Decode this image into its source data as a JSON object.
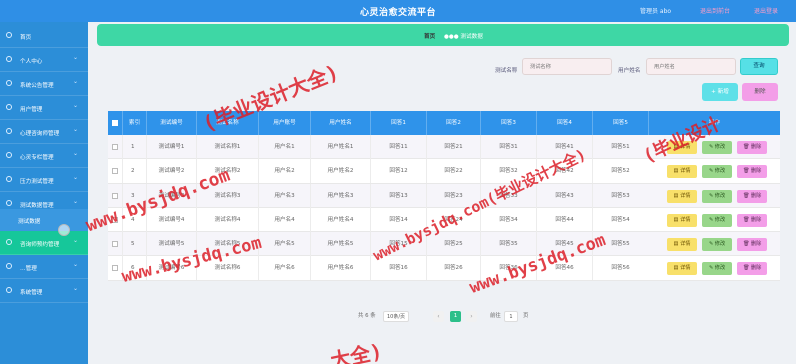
{
  "header": {
    "title": "心灵治愈交流平台",
    "user": "管理员 abo",
    "exit_label": "退出到前台",
    "logout_label": "退出登录"
  },
  "sidebar": {
    "items": [
      {
        "label": "首页",
        "chevron": false,
        "active": false
      },
      {
        "label": "个人中心",
        "chevron": true,
        "active": false
      },
      {
        "label": "系统公告管理",
        "chevron": true,
        "active": false
      },
      {
        "label": "用户管理",
        "chevron": true,
        "active": false
      },
      {
        "label": "心理咨询师管理",
        "chevron": true,
        "active": false
      },
      {
        "label": "心灵专栏管理",
        "chevron": true,
        "active": false
      },
      {
        "label": "压力测试管理",
        "chevron": true,
        "active": false
      },
      {
        "label": "测试数据管理",
        "chevron": true,
        "active": false
      },
      {
        "label": "咨询师预约管理",
        "chevron": true,
        "active": true
      },
      {
        "label": "…管理",
        "chevron": true,
        "active": false
      },
      {
        "label": "系统管理",
        "chevron": true,
        "active": false
      }
    ],
    "sub_item": "测试数据"
  },
  "breadcrumb": {
    "home": "首页",
    "current": "●●● 测试数据"
  },
  "search": {
    "label1": "测试名称",
    "placeholder1": "测试名称",
    "label2": "用户姓名",
    "placeholder2": "用户姓名",
    "button": "查询"
  },
  "toolbar": {
    "add_label": "+ 新增",
    "delete_label": "删除"
  },
  "table": {
    "columns": [
      "索引",
      "测试编号",
      "测试名称",
      "用户账号",
      "用户姓名",
      "回答1",
      "回答2",
      "回答3",
      "回答4",
      "回答5",
      "操作"
    ],
    "rows": [
      [
        "1",
        "测试编号1",
        "测试名称1",
        "用户名1",
        "用户姓名1",
        "回答11",
        "回答21",
        "回答31",
        "回答41",
        "回答51"
      ],
      [
        "2",
        "测试编号2",
        "测试名称2",
        "用户名2",
        "用户姓名2",
        "回答12",
        "回答22",
        "回答32",
        "回答42",
        "回答52"
      ],
      [
        "3",
        "测试编号3",
        "测试名称3",
        "用户名3",
        "用户姓名3",
        "回答13",
        "回答23",
        "回答33",
        "回答43",
        "回答53"
      ],
      [
        "4",
        "测试编号4",
        "测试名称4",
        "用户名4",
        "用户姓名4",
        "回答14",
        "回答24",
        "回答34",
        "回答44",
        "回答54"
      ],
      [
        "5",
        "测试编号5",
        "测试名称5",
        "用户名5",
        "用户姓名5",
        "回答15",
        "回答25",
        "回答35",
        "回答45",
        "回答55"
      ],
      [
        "6",
        "测试编号6",
        "测试名称6",
        "用户名6",
        "用户姓名6",
        "回答16",
        "回答26",
        "回答36",
        "回答46",
        "回答56"
      ]
    ],
    "actions": {
      "detail": "▤ 详情",
      "edit": "✎ 修改",
      "delete": "🗑 删除"
    }
  },
  "pagination": {
    "total": "共 6 条",
    "page_size": "10条/页",
    "current_page": "1",
    "goto_label": "前往",
    "goto_value": "1",
    "page_suffix": "页"
  },
  "watermarks": [
    "(毕业设计大全)",
    "(毕业设计",
    "www.bysjdq.com",
    "www.bysjdq.com(毕业设计大全)",
    "www.bysjdq.com",
    "www.bysjdq.com",
    "大全)"
  ]
}
